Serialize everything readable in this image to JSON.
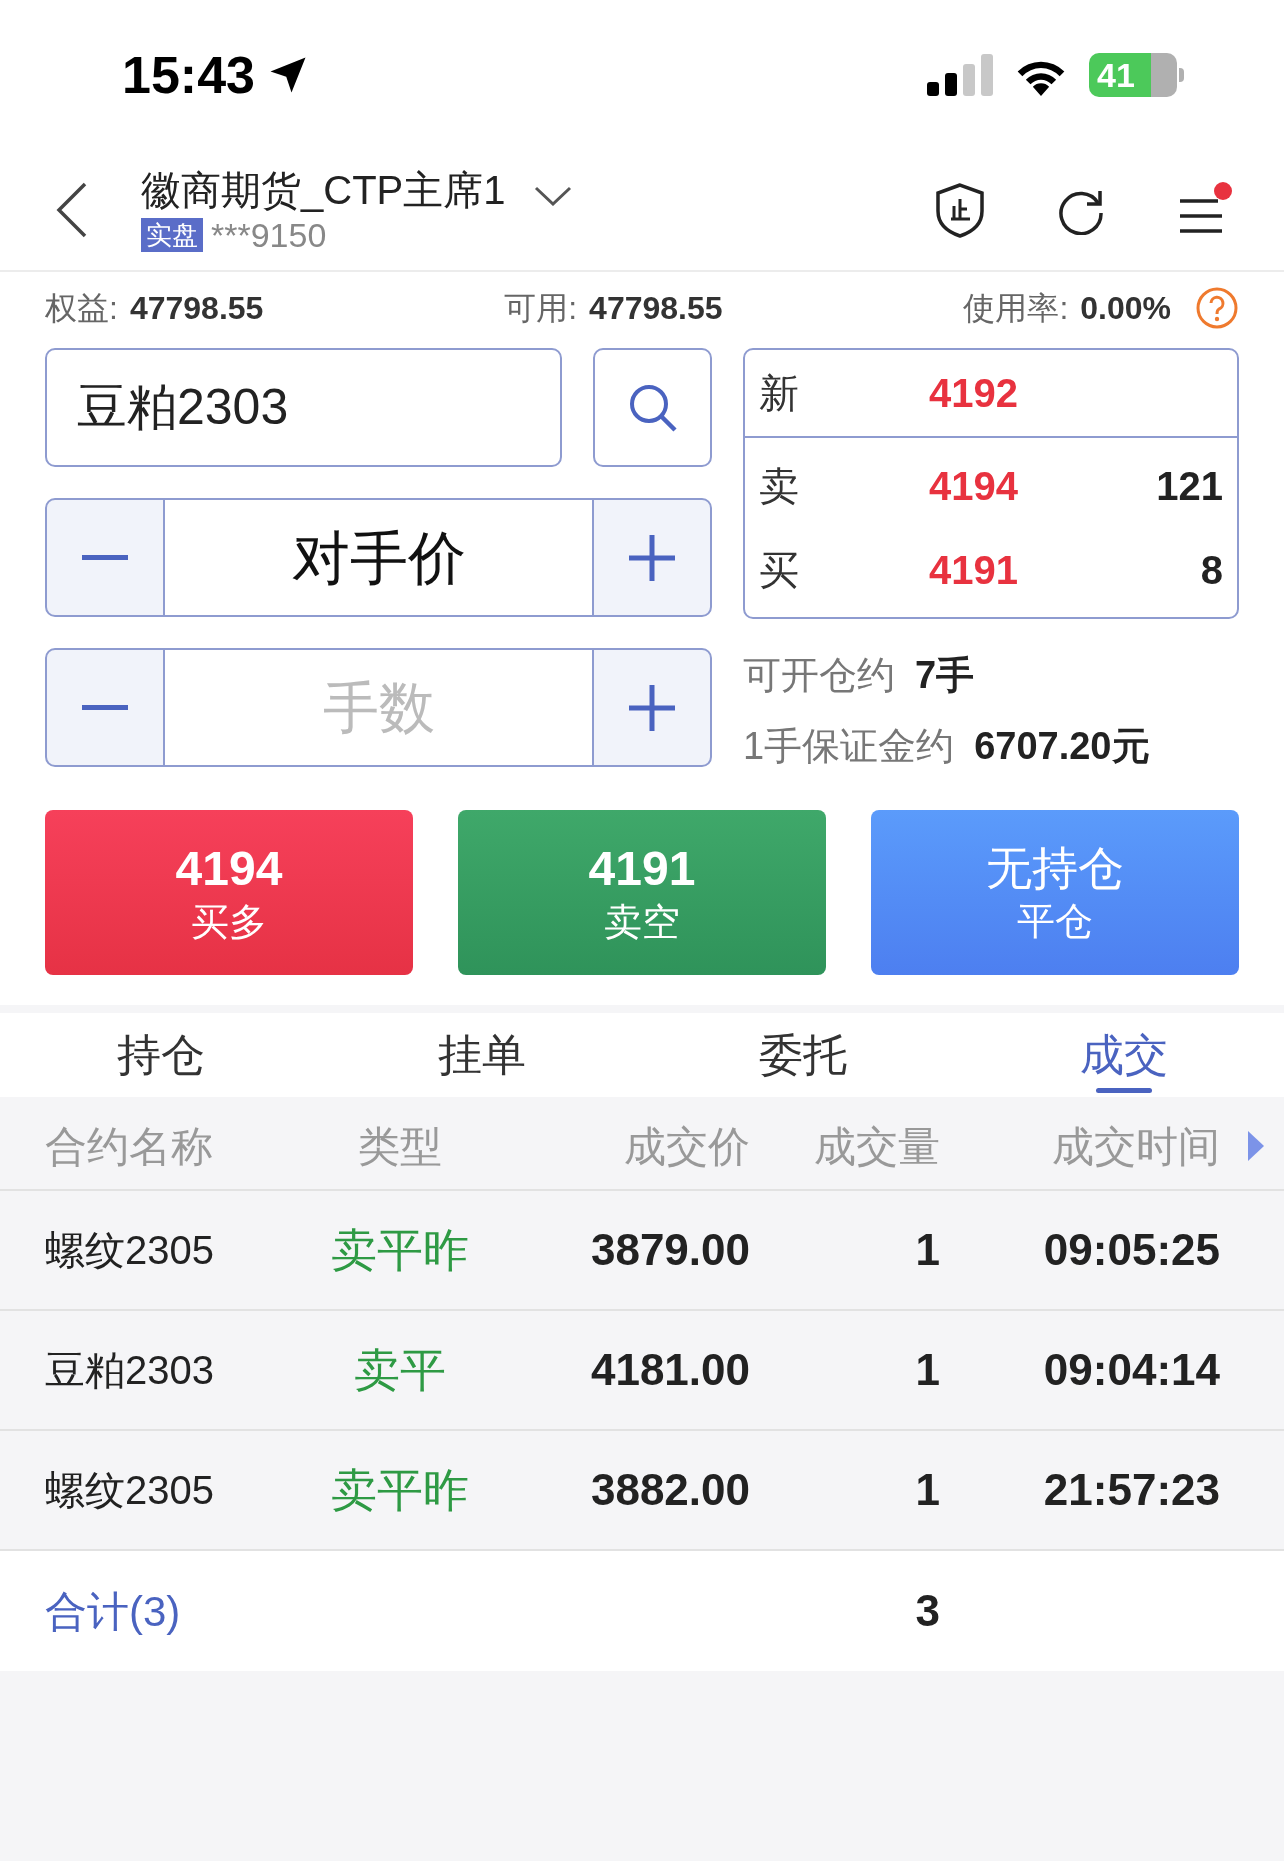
{
  "status_bar": {
    "time": "15:43",
    "battery": "41"
  },
  "header": {
    "title": "徽商期货_CTP主席1",
    "badge": "实盘",
    "account": "***9150"
  },
  "account_summary": [
    {
      "label": "权益:",
      "value": "47798.55"
    },
    {
      "label": "可用:",
      "value": "47798.55"
    },
    {
      "label": "使用率:",
      "value": "0.00%"
    }
  ],
  "contract": {
    "value": "豆粕2303"
  },
  "quote": [
    {
      "label": "新",
      "price": "4192"
    },
    {
      "label": "卖",
      "price": "4194",
      "volume": "121"
    },
    {
      "label": "买",
      "price": "4191",
      "volume": "8"
    }
  ],
  "price_stepper": {
    "value": "对手价"
  },
  "quantity_stepper": {
    "placeholder": "手数"
  },
  "margin_info": [
    {
      "label": "可开仓约",
      "value": "7手"
    },
    {
      "label": "1手保证金约",
      "value": "6707.20元"
    }
  ],
  "actions": [
    {
      "kind": "buy",
      "line1": "4194",
      "line2": "买多"
    },
    {
      "kind": "sell",
      "line1": "4191",
      "line2": "卖空"
    },
    {
      "kind": "close",
      "line1": "无持仓",
      "line2": "平仓"
    }
  ],
  "tabs": [
    {
      "label": "持仓",
      "selected": false
    },
    {
      "label": "挂单",
      "selected": false
    },
    {
      "label": "委托",
      "selected": false
    },
    {
      "label": "成交",
      "selected": true
    }
  ],
  "table": {
    "columns": [
      "合约名称",
      "类型",
      "成交价",
      "成交量",
      "成交时间"
    ],
    "rows": [
      {
        "cells": [
          "螺纹2305",
          "卖平昨",
          "3879.00",
          "1",
          "09:05:25"
        ]
      },
      {
        "cells": [
          "豆粕2303",
          "卖平",
          "4181.00",
          "1",
          "09:04:14"
        ]
      },
      {
        "cells": [
          "螺纹2305",
          "卖平昨",
          "3882.00",
          "1",
          "21:57:23"
        ]
      }
    ],
    "total": {
      "label": "合计(3)",
      "quantity": "3"
    }
  }
}
